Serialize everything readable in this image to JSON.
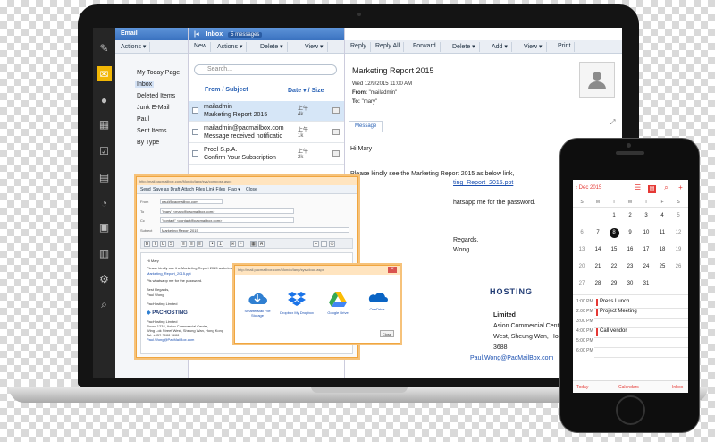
{
  "app": {
    "folders_header": "Email",
    "folders_actions": "Actions ▾",
    "folders": [
      "My Today Page",
      "Inbox",
      "Deleted Items",
      "Junk E-Mail",
      "Paul",
      "Sent Items",
      "By Type"
    ],
    "inbox_label": "Inbox",
    "inbox_count": "5 messages",
    "list_toolbar": [
      "New",
      "Actions ▾",
      "Delete ▾",
      "View ▾"
    ],
    "search_placeholder": "Search...",
    "col_from": "From / Subject",
    "col_date": "Date ▾ / Size",
    "messages": [
      {
        "from": "mailadmin",
        "subject": "Marketing Report 2015",
        "time": "上午",
        "size": "4k"
      },
      {
        "from": "mailadmin@pacmailbox.com",
        "subject": "Message received notificatio",
        "time": "上午",
        "size": "1k"
      },
      {
        "from": "Proel S.p.A.",
        "subject": "Confirm Your Subscription",
        "time": "上午",
        "size": "2k"
      },
      {
        "from": "",
        "subject": "",
        "time": "",
        "size": ""
      }
    ],
    "read_toolbar": [
      "Reply",
      "Reply All",
      "Forward",
      "Delete ▾",
      "Add ▾",
      "View ▾",
      "Print"
    ],
    "subject": "Marketing Report 2015",
    "date": "Wed 12/9/2015 11:00 AM",
    "from_label": "From:",
    "from_value": "\"mailadmin\"",
    "to_label": "To:",
    "to_value": "\"mary\"",
    "message_tab": "Message",
    "body": {
      "greeting": "Hi Mary",
      "line1": "Please kindly see the Marketing Report 2015 as below link,",
      "link1": "ting_Report_2015.ppt",
      "line2": "hatsapp me for the password.",
      "regards": "Regards,",
      "name": "Wong",
      "logo_text": "HOSTING",
      "company": "Limited",
      "addr1": "Asion Commercial Centre,",
      "addr2": "West, Sheung Wan, Hong Kong",
      "phone": "3688",
      "email": "Paul.Wong@PacMailBox.com"
    }
  },
  "compose": {
    "title": "http://mail.pacmailbox.com/Mondo/lang/sys/compose.aspx",
    "menu": [
      "Send",
      "Save as Draft",
      "Attach Files",
      "Link Files",
      "Flag ▾",
      "Close"
    ],
    "from_label": "From",
    "from_value": "paul@pacmailbox.com",
    "to_label": "To",
    "to_value": "\"mary\" <mary@pacmailbox.com>",
    "cc_label": "Cc",
    "cc_value": "\"contact\" <contact@pacmailbox.com>",
    "subject_label": "Subject",
    "subject_value": "Marketing Report 2015",
    "body_lines": [
      "Hi Mary",
      "Please kindly see the Marketing Report 2015 as below link,",
      "Marketing_Report_2015.ppt",
      "Pls whatsapp me for the password.",
      "Best Regards,",
      "Paul Wong",
      "PacHosting Limited"
    ],
    "logo": "PACHOSTING",
    "sig_lines": [
      "PacHosting Limited",
      "Room 1234, Asion Commercial Centre,",
      "Wing Lok Street West, Sheung Wan, Hong Kong",
      "Tel: +852 3688 3688",
      "Paul.Wong@PacMailBox.com"
    ]
  },
  "picker": {
    "title": "http://mail.pacmailbox.com/Mondo/lang/sys/cloud.aspx",
    "services": [
      {
        "name": "SmarterMail File Storage",
        "color": "#2f7fd1"
      },
      {
        "name": "Dropbox My Dropbox",
        "color": "#1a73e8"
      },
      {
        "name": "Google Drive",
        "color": "#34a853"
      },
      {
        "name": "OneDrive",
        "color": "#0a64c4"
      }
    ],
    "close": "Close"
  },
  "calendar": {
    "back": "Dec 2015",
    "weekdays": [
      "S",
      "M",
      "T",
      "W",
      "T",
      "F",
      "S"
    ],
    "weeks": [
      [
        "1",
        "2",
        "3",
        "4",
        "5"
      ],
      [
        "6",
        "7",
        "8",
        "9",
        "10",
        "11",
        "12"
      ],
      [
        "13",
        "14",
        "15",
        "16",
        "17",
        "18",
        "19"
      ],
      [
        "20",
        "21",
        "22",
        "23",
        "24",
        "25",
        "26"
      ],
      [
        "27",
        "28",
        "29",
        "30",
        "31"
      ]
    ],
    "selected_day": "8",
    "events": [
      {
        "time": "1:00 PM",
        "title": "Press Lunch"
      },
      {
        "time": "2:00 PM",
        "title": "Project Meeting"
      },
      {
        "time": "3:00 PM",
        "title": ""
      },
      {
        "time": "4:00 PM",
        "title": "Call vendor"
      },
      {
        "time": "5:00 PM",
        "title": ""
      },
      {
        "time": "6:00 PM",
        "title": ""
      }
    ],
    "footer": [
      "Today",
      "Calendars",
      "Inbox"
    ],
    "accent": "#e53935"
  }
}
